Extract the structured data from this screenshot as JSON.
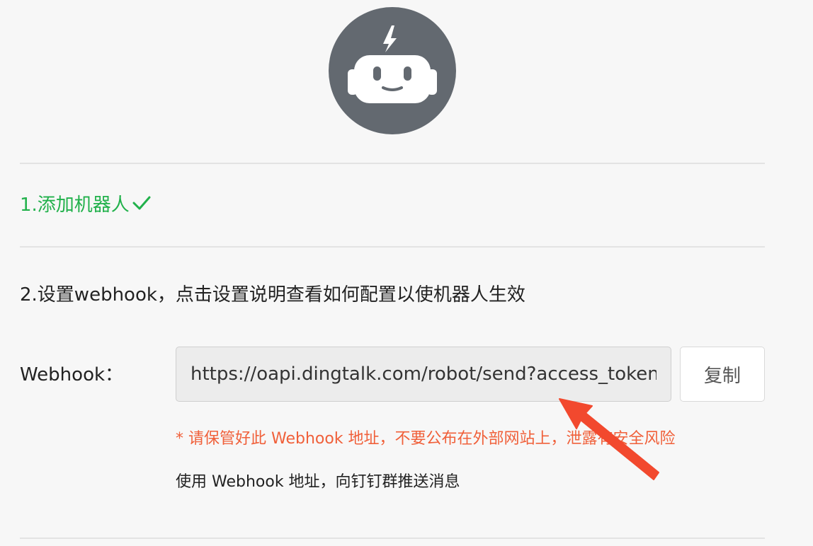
{
  "robot_avatar": {
    "icon": "robot-icon",
    "background_color": "#636970"
  },
  "steps": {
    "step1_label": "1.添加机器人",
    "step1_check_icon": "checkmark-icon",
    "step1_color": "#21b14b",
    "step2_label": "2.设置webhook，点击设置说明查看如何配置以使机器人生效"
  },
  "webhook": {
    "label": "Webhook：",
    "value": "https://oapi.dingtalk.com/robot/send?access_token=",
    "copy_label": "复制",
    "warning": "* 请保管好此 Webhook 地址，不要公布在外部网站上，泄露有安全风险",
    "warning_color": "#f0603a",
    "usage": "使用 Webhook 地址，向钉钉群推送消息"
  },
  "annotation": {
    "arrow_color": "#f2492e"
  }
}
